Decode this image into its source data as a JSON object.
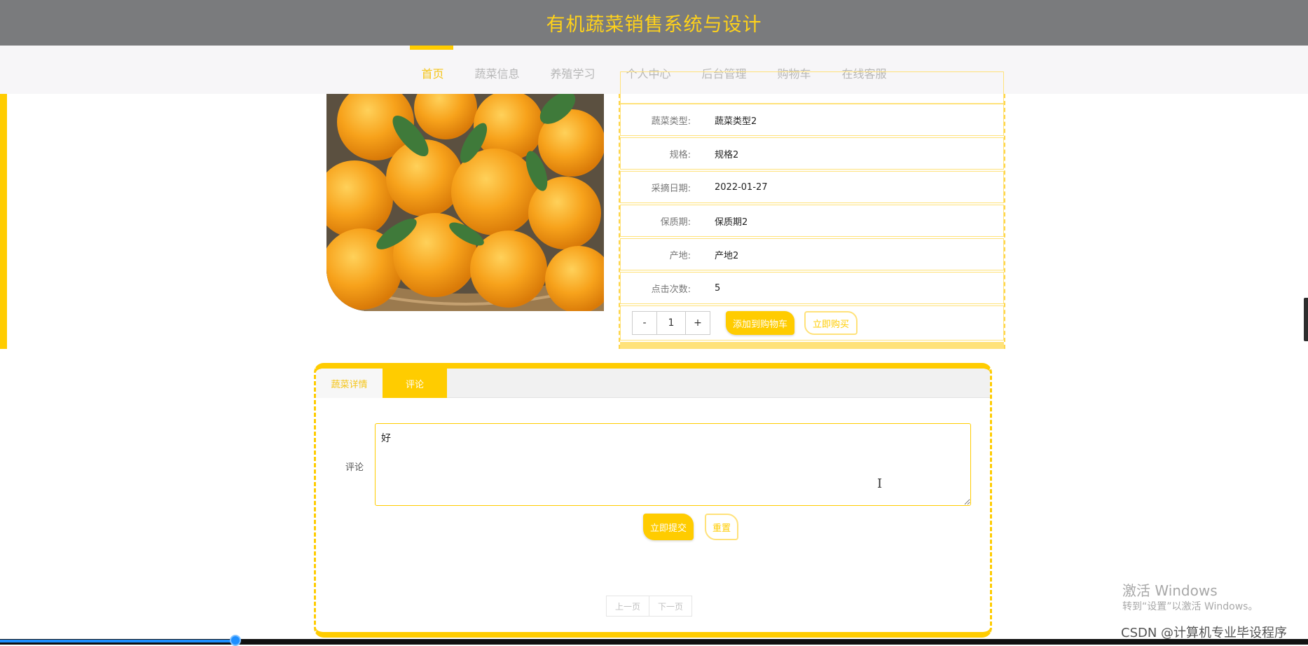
{
  "header": {
    "title": "有机蔬菜销售系统与设计"
  },
  "nav": {
    "items": [
      "首页",
      "蔬菜信息",
      "养殖学习",
      "个人中心",
      "后台管理",
      "购物车",
      "在线客服"
    ],
    "active_index": 0
  },
  "product": {
    "image_alt": "oranges",
    "fields": [
      {
        "label": "蔬菜类型:",
        "value": "蔬菜类型2"
      },
      {
        "label": "规格:",
        "value": "规格2"
      },
      {
        "label": "采摘日期:",
        "value": "2022-01-27"
      },
      {
        "label": "保质期:",
        "value": "保质期2"
      },
      {
        "label": "产地:",
        "value": "产地2"
      },
      {
        "label": "点击次数:",
        "value": "5"
      }
    ],
    "quantity": {
      "minus": "-",
      "value": "1",
      "plus": "+"
    },
    "add_to_cart_label": "添加到购物车",
    "buy_now_label": "立即购买"
  },
  "tabs": {
    "items": [
      "蔬菜详情",
      "评论"
    ],
    "active_index": 1
  },
  "comment": {
    "label": "评论",
    "value": "好",
    "submit_label": "立即提交",
    "reset_label": "重置"
  },
  "pager": {
    "prev_label": "上一页",
    "next_label": "下一页"
  },
  "watermark": {
    "line1": "激活 Windows",
    "line2": "转到“设置”以激活 Windows。",
    "csdn": "CSDN @计算机专业毕设程序"
  },
  "video": {
    "progress": 0.18
  },
  "colors": {
    "accent": "#ffcc00",
    "header_bg": "#7a7b7d",
    "title": "#ffd21a"
  }
}
